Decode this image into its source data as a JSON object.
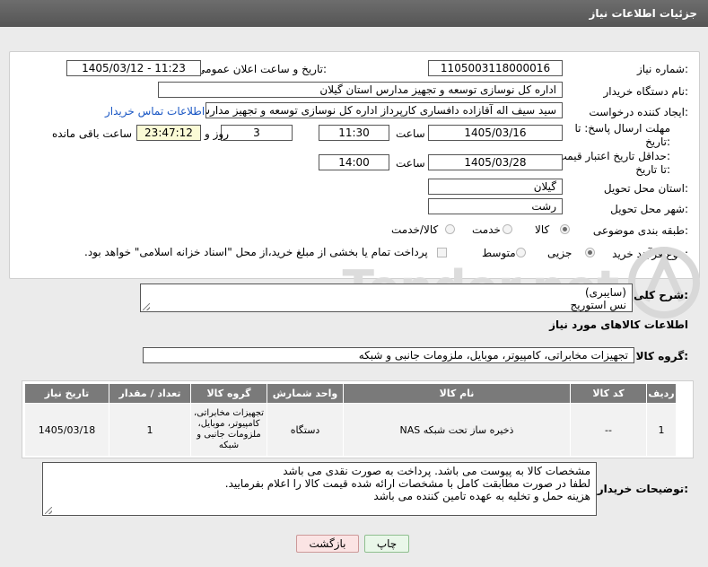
{
  "header": {
    "title": "جزئیات اطلاعات نیاز"
  },
  "form": {
    "need_number_label": "شماره نیاز:",
    "need_number": "1105003118000016",
    "announce_label": "تاریخ و ساعت اعلان عمومی:",
    "announce_value": "1405/03/12 - 11:23",
    "buyer_org_label": "نام دستگاه خریدار:",
    "buyer_org": "اداره کل نوسازی  توسعه و تجهیز مدارس استان گیلان",
    "creator_label": "ایجاد کننده درخواست:",
    "creator": "سید سیف اله آقازاده دافساری کارپرداز اداره کل نوسازی  توسعه و تجهیز مدارس",
    "contact_link": "اطلاعات تماس خریدار",
    "reply_deadline_label_1": "مهلت ارسال پاسخ: تا",
    "reply_deadline_label_2": "تاریخ:",
    "reply_date": "1405/03/16",
    "time_label": "ساعت",
    "reply_time": "11:30",
    "days_value": "3",
    "days_label": "روز و",
    "remaining_time": "23:47:12",
    "remaining_label": "ساعت باقی مانده",
    "price_validity_label_1": "حداقل تاریخ اعتبار قیمت:",
    "price_validity_label_2": "تا تاریخ:",
    "validity_date": "1405/03/28",
    "validity_time": "14:00",
    "province_label": "استان محل تحویل:",
    "province": "گیلان",
    "city_label": "شهر محل تحویل:",
    "city": "رشت",
    "category_label": "طبقه بندی موضوعی:",
    "category_options": [
      "کالا",
      "خدمت",
      "کالا/خدمت"
    ],
    "process_label": "نوع فرآیند خرید :",
    "process_options": [
      "جزیی",
      "متوسط"
    ],
    "payment_note": "پرداخت تمام یا بخشی از مبلغ خرید،از محل \"اسناد خزانه اسلامی\" خواهد بود."
  },
  "summary": {
    "label": "شرح کلی نیاز:",
    "line1": "(سایبری)",
    "line2": "نس استوریج"
  },
  "goods": {
    "section_title": "اطلاعات کالاهای مورد نیاز",
    "group_label": "گروه کالا:",
    "group_value": "تجهیزات مخابراتی، کامپیوتر، موبایل، ملزومات جانبی و شبکه",
    "headers": [
      "ردیف",
      "کد کالا",
      "نام کالا",
      "واحد شمارش",
      "گروه کالا",
      "تعداد / مقدار",
      "تاریخ نیاز"
    ],
    "rows": [
      {
        "row": "1",
        "code": "--",
        "name": "ذخیره ساز تحت شبکه NAS",
        "unit": "دستگاه",
        "group": "تجهیزات مخابراتی، کامپیوتر، موبایل، ملزومات جانبی و شبکه",
        "qty": "1",
        "date": "1405/03/18"
      }
    ]
  },
  "buyer_notes": {
    "label": "توضیحات خریدار:",
    "line1": "مشخصات کالا به پیوست می باشد. پرداخت به صورت نقدی می باشد",
    "line2": "لطفا در صورت مطابقت کامل با مشخصات ارائه شده قیمت کالا را اعلام بفرمایید.",
    "line3": "هزینه حمل و تخلیه به عهده تامین کننده می باشد"
  },
  "buttons": {
    "print": "چاپ",
    "back": "بازگشت"
  },
  "watermark": {
    "text": "AriaTender.net"
  }
}
